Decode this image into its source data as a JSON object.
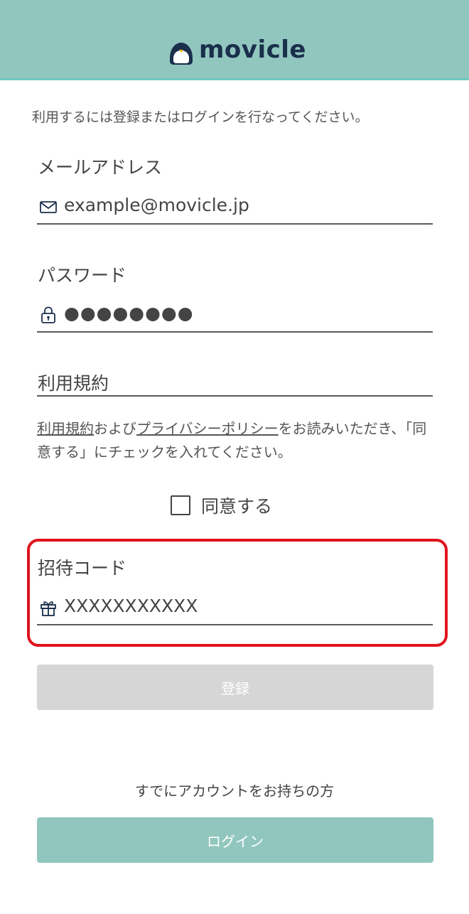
{
  "header": {
    "brand": "movicle",
    "bg_color": "#91c6be",
    "logo_color": "#1a2f4b"
  },
  "intro_text": "利用するには登録またはログインを行なってください。",
  "email": {
    "label": "メールアドレス",
    "placeholder": "example@movicle.jp",
    "icon": "mail-icon"
  },
  "password": {
    "label": "パスワード",
    "value": "●●●●●●●●",
    "icon": "lock-icon"
  },
  "terms": {
    "heading": "利用規約",
    "terms_link": "利用規約",
    "text_and": "および",
    "privacy_link": "プライバシーポリシー",
    "text_rest": "をお読みいただき、「同意する」にチェックを入れてください。",
    "agree_label": "同意する",
    "agreed": false
  },
  "invite": {
    "label": "招待コード",
    "placeholder": "XXXXXXXXXXX",
    "icon": "gift-icon",
    "highlight_color": "#e0141e"
  },
  "register_button": "登録",
  "have_account_text": "すでにアカウントをお持ちの方",
  "login_button": "ログイン"
}
